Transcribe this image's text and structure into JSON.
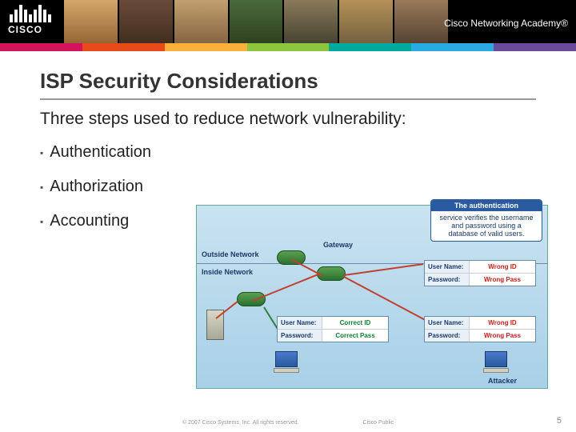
{
  "header": {
    "brand": "CISCO",
    "program": "Cisco Networking Academy®"
  },
  "slide": {
    "title": "ISP Security Considerations",
    "subtitle": "Three steps used to reduce network vulnerability:",
    "bullets": [
      "Authentication",
      "Authorization",
      "Accounting"
    ]
  },
  "diagram": {
    "callout_title": "The authentication",
    "callout_body": "service verifies the username and password using a database of valid users.",
    "outside_label": "Outside Network",
    "inside_label": "Inside Network",
    "gateway_label": "Gateway",
    "attacker_label": "Attacker",
    "fields": {
      "user": "User Name:",
      "pass": "Password:"
    },
    "attempts": [
      {
        "user_val": "Wrong ID",
        "pass_val": "Wrong Pass",
        "status": "wrong"
      },
      {
        "user_val": "Correct ID",
        "pass_val": "Correct Pass",
        "status": "correct"
      },
      {
        "user_val": "Wrong ID",
        "pass_val": "Wrong Pass",
        "status": "wrong"
      }
    ]
  },
  "footer": {
    "copyright": "© 2007 Cisco Systems, Inc. All rights reserved.",
    "classification": "Cisco Public",
    "page": "5"
  }
}
